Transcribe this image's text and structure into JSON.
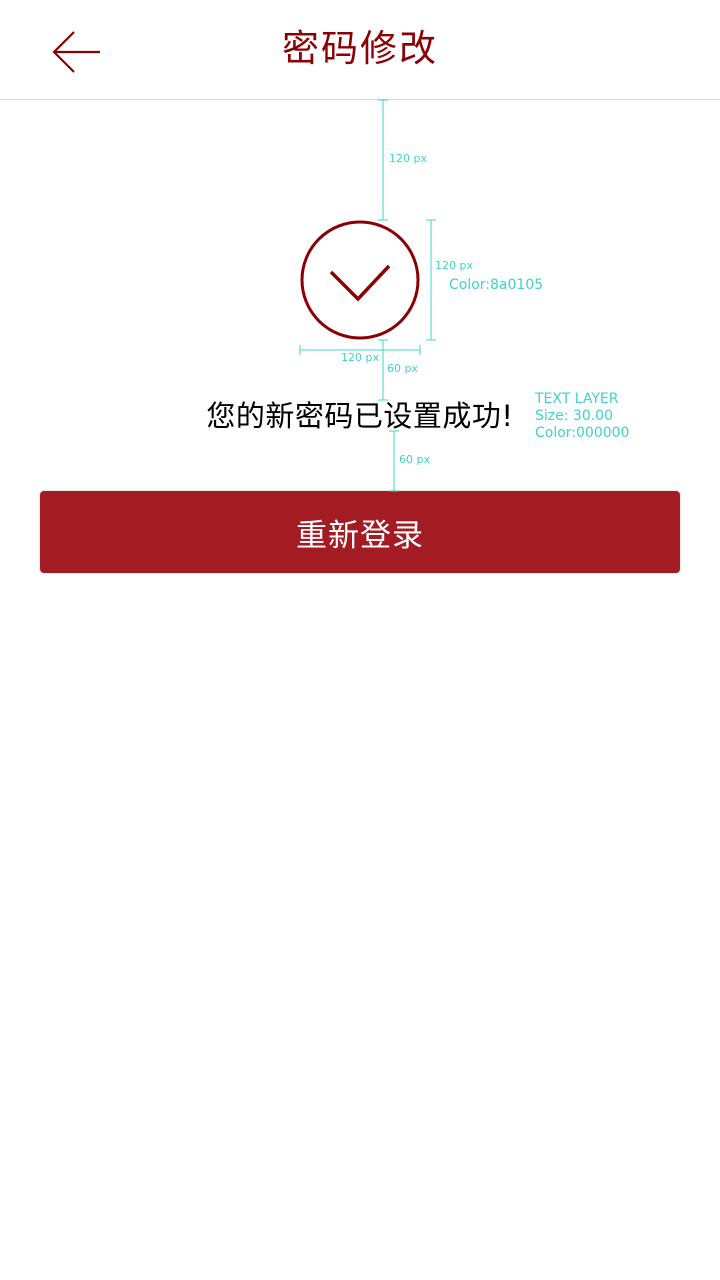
{
  "colors": {
    "accent": "#8a0105",
    "button_bg": "#a31c24",
    "annotation": "#3fd4c4",
    "header_border": "#d9d9d9"
  },
  "header": {
    "back_icon": "arrow-left-icon",
    "title": "密码修改"
  },
  "main": {
    "success_icon": "check-circle-icon",
    "message": "您的新密码已设置成功!",
    "relogin_label": "重新登录"
  },
  "annotations": {
    "gap_top": "120 px",
    "icon_height": "120 px",
    "icon_color": "Color:8a0105",
    "icon_width": "120 px",
    "gap_icon_text": "60 px",
    "gap_text_button": "60 px",
    "text_layer": {
      "line1": "TEXT LAYER",
      "line2": "Size: 30.00",
      "line3": "Color:000000"
    }
  }
}
